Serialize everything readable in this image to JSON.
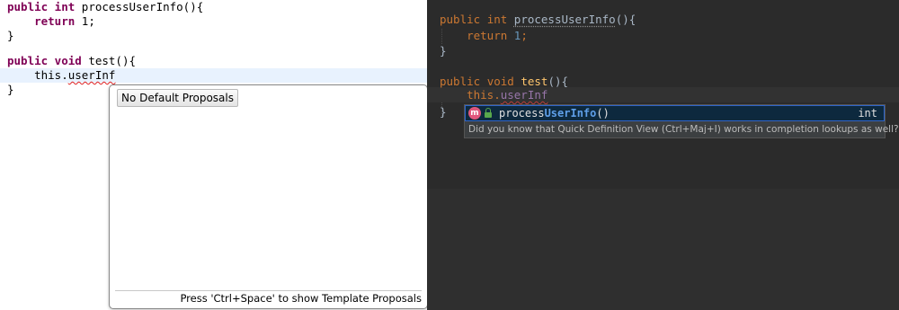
{
  "eclipse": {
    "lines": {
      "l1_kw": "public int ",
      "l1_rest": "processUserInfo(){",
      "l2_kw": "    return ",
      "l2_rest": "1;",
      "l3": "}",
      "l5_kw": "public void ",
      "l5_rest": "test(){",
      "l6_prefix": "    this.",
      "l6_typed": "userInf",
      "l7": "}"
    },
    "popup": {
      "no_proposals_label": "No Default Proposals",
      "footer_hint": "Press 'Ctrl+Space' to show Template Proposals"
    }
  },
  "intellij": {
    "lines": {
      "l1_kw1": "public ",
      "l1_kw2": "int ",
      "l1_name": "processUserInfo",
      "l1_rest": "(){",
      "l2_kw": "    return ",
      "l2_num": "1",
      "l2_end": ";",
      "l3": "}",
      "l5_kw1": "public ",
      "l5_kw2": "void ",
      "l5_name": "test",
      "l5_rest": "(){",
      "l6_prefix": "    this.",
      "l6_typed": "userInf",
      "l7": "}"
    },
    "completion": {
      "method_icon_letter": "m",
      "item_prefix": "process",
      "item_match": "UserInfo",
      "item_suffix": "()",
      "item_type": "int",
      "hint_text": "Did you know that Quick Definition View (Ctrl+Maj+I) works in completion lookups as well?",
      "hint_link": ">>"
    },
    "colors": {
      "background": "#2b2b2b",
      "keyword": "#cc7832",
      "number": "#6897bb",
      "function": "#ffc66d",
      "field": "#9876aa",
      "selection": "#0d293e",
      "match_highlight": "#5f9fe8"
    }
  }
}
